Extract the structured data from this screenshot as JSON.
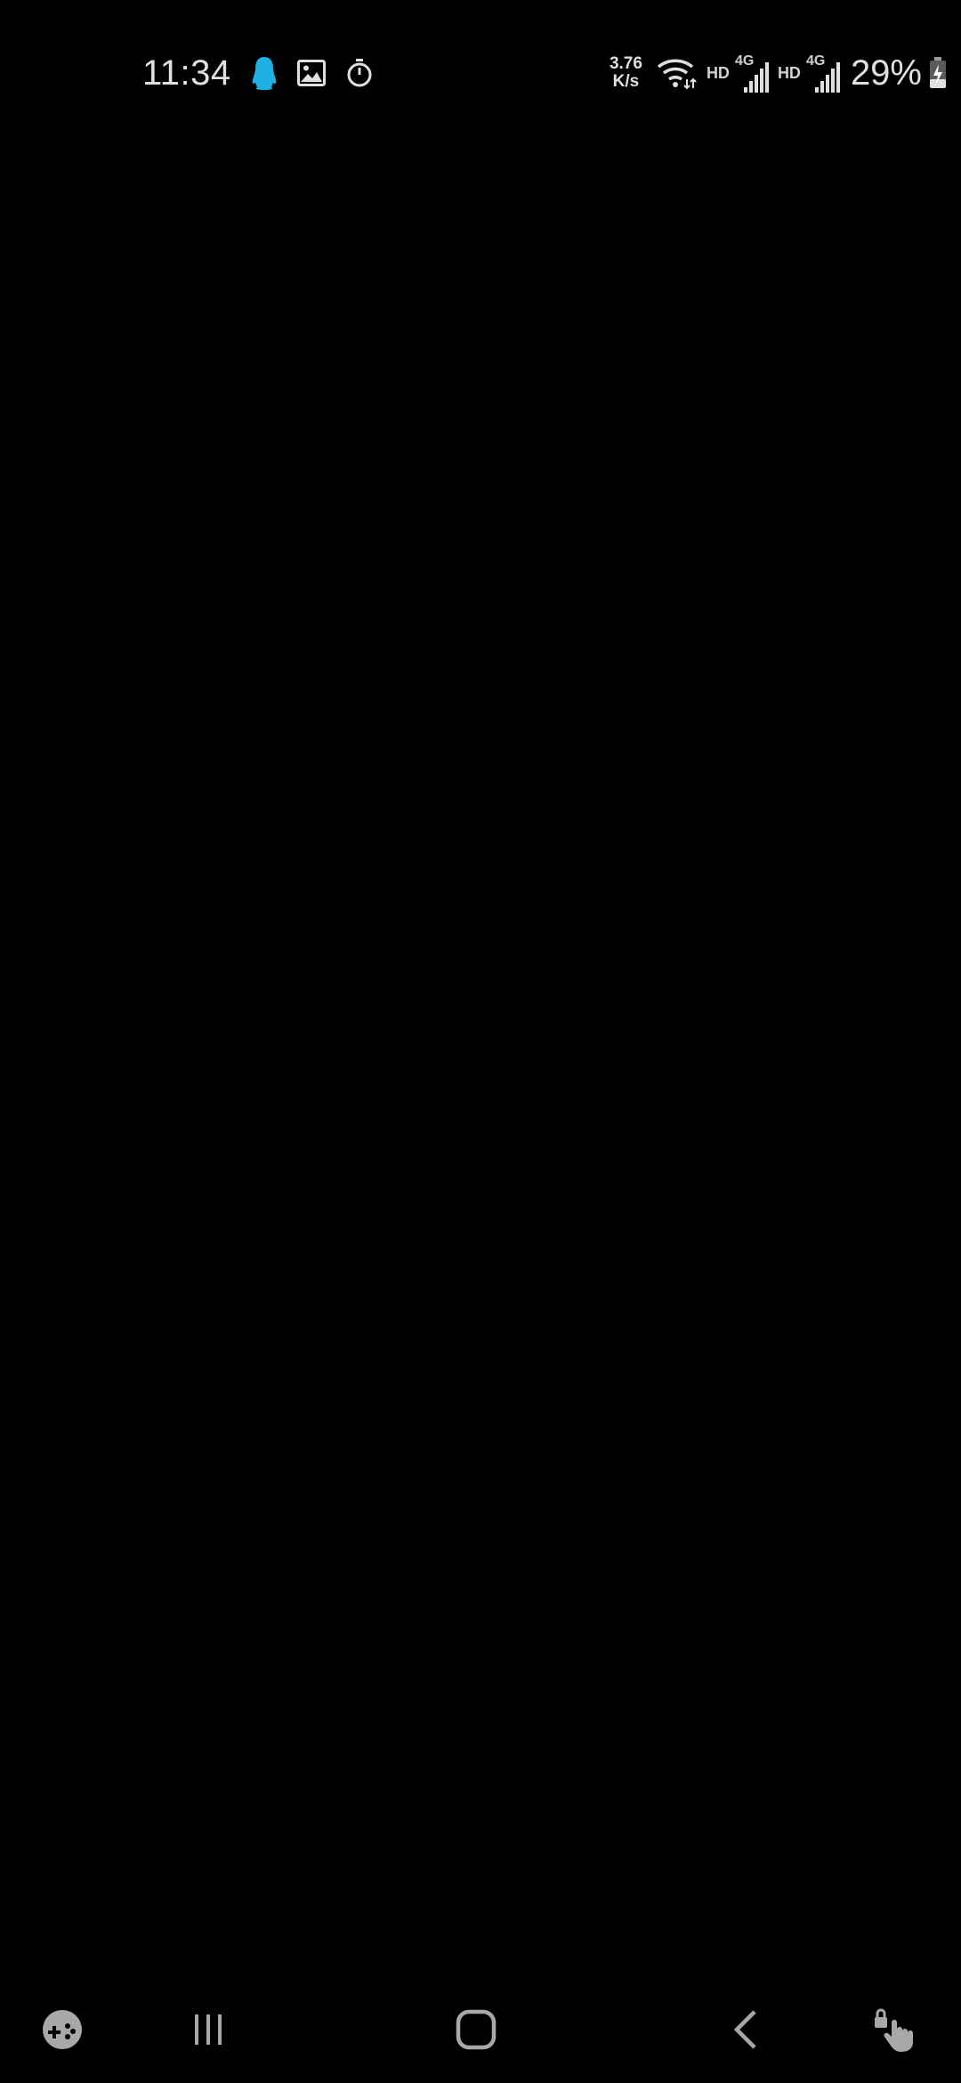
{
  "status_bar": {
    "time": "11:34",
    "notification_icons": [
      "qq-penguin-icon",
      "gallery-image-icon",
      "stopwatch-icon"
    ],
    "network_speed_value": "3.76",
    "network_speed_unit": "K/s",
    "sim1_label": "HD",
    "sim1_network": "4G",
    "sim2_label": "HD",
    "sim2_network": "4G",
    "battery_percent": "29%",
    "battery_charging": true
  },
  "navigation_bar": {
    "buttons": [
      "game-tools-icon",
      "recent-apps-icon",
      "home-icon",
      "back-icon",
      "screen-pin-icon"
    ]
  },
  "colors": {
    "background": "#000000",
    "status_text": "#e0e0e0",
    "qq_icon": "#1fb0e6",
    "nav_icon": "#a8a8a8"
  }
}
